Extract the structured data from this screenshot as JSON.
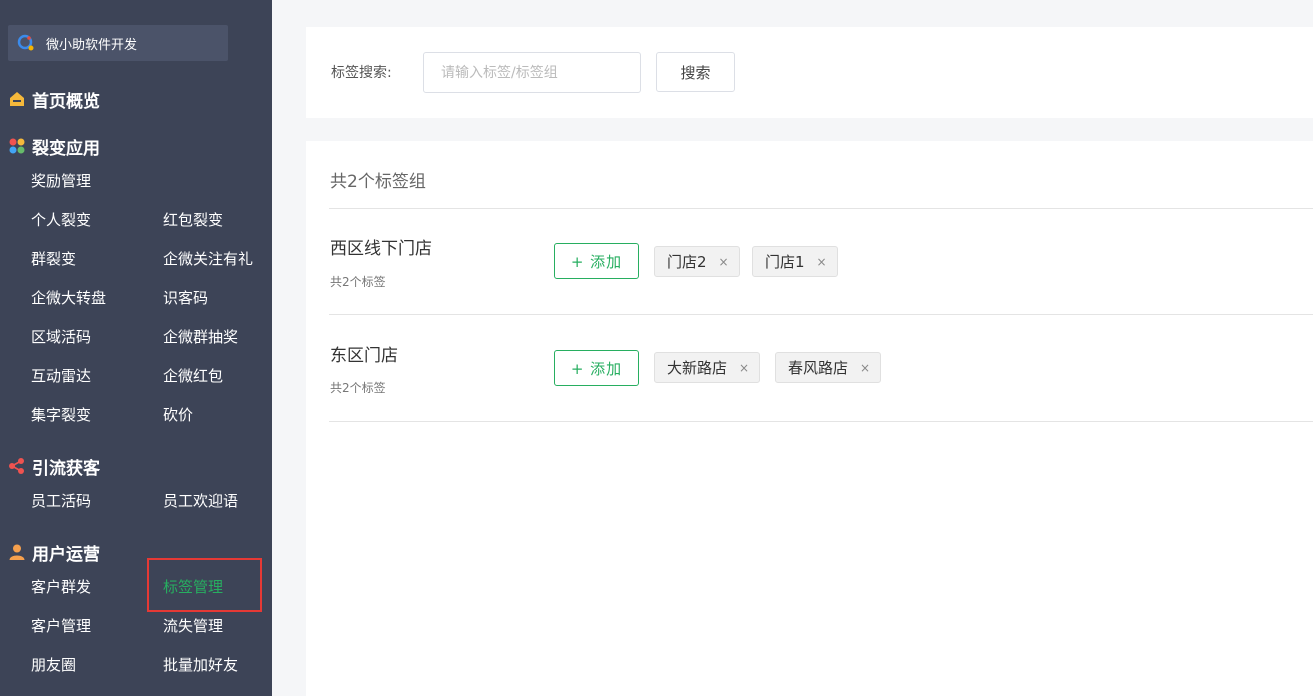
{
  "sidebar": {
    "brand": "微小助软件开发",
    "sections": [
      {
        "title": "首页概览",
        "icon": "home-icon",
        "items": []
      },
      {
        "title": "裂变应用",
        "icon": "apps-icon",
        "items": [
          "奖励管理",
          "个人裂变",
          "红包裂变",
          "群裂变",
          "企微关注有礼",
          "企微大转盘",
          "识客码",
          "区域活码",
          "企微群抽奖",
          "互动雷达",
          "企微红包",
          "集字裂变",
          "砍价"
        ]
      },
      {
        "title": "引流获客",
        "icon": "share-icon",
        "items": [
          "员工活码",
          "员工欢迎语"
        ]
      },
      {
        "title": "用户运营",
        "icon": "user-icon",
        "items": [
          "客户群发",
          "标签管理",
          "客户管理",
          "流失管理",
          "朋友圈",
          "批量加好友"
        ]
      }
    ],
    "active_item": "标签管理"
  },
  "search": {
    "label": "标签搜索:",
    "placeholder": "请输入标签/标签组",
    "value": "",
    "button_label": "搜索"
  },
  "groups": {
    "summary": "共2个标签组",
    "add_label": "+ 添加",
    "close_glyph": "×",
    "list": [
      {
        "name": "西区线下门店",
        "count_text": "共2个标签",
        "tags": [
          "门店2",
          "门店1"
        ]
      },
      {
        "name": "东区门店",
        "count_text": "共2个标签",
        "tags": [
          "大新路店",
          "春风路店"
        ]
      }
    ]
  },
  "colors": {
    "sidebar_bg": "#3d4457",
    "accent_green": "#27ae60",
    "highlight_red": "#e53935"
  }
}
